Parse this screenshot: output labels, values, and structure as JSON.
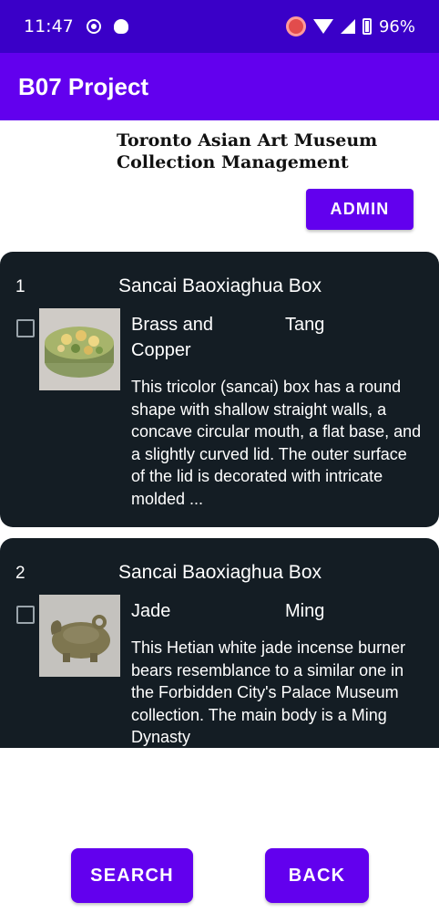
{
  "status_bar": {
    "time": "11:47",
    "battery": "96%"
  },
  "app_bar": {
    "title": "B07 Project"
  },
  "subtitle": "Toronto Asian Art Museum Collection Management",
  "admin_button": "ADMIN",
  "items": [
    {
      "index": "1",
      "title": "Sancai Baoxiaghua Box",
      "material": "Brass and Copper",
      "period": "Tang",
      "description": "This tricolor (sancai) box has a round shape with shallow straight walls, a concave circular mouth, a flat base, and a slightly curved lid. The outer surface of the lid is decorated with intricate molded ..."
    },
    {
      "index": "2",
      "title": "Sancai Baoxiaghua Box",
      "material": "Jade",
      "period": "Ming",
      "description": "This Hetian white jade incense burner bears resemblance to a similar one in the Forbidden City's Palace Museum collection. The main body is a Ming Dynasty"
    }
  ],
  "search_button": "SEARCH",
  "back_button": "BACK"
}
